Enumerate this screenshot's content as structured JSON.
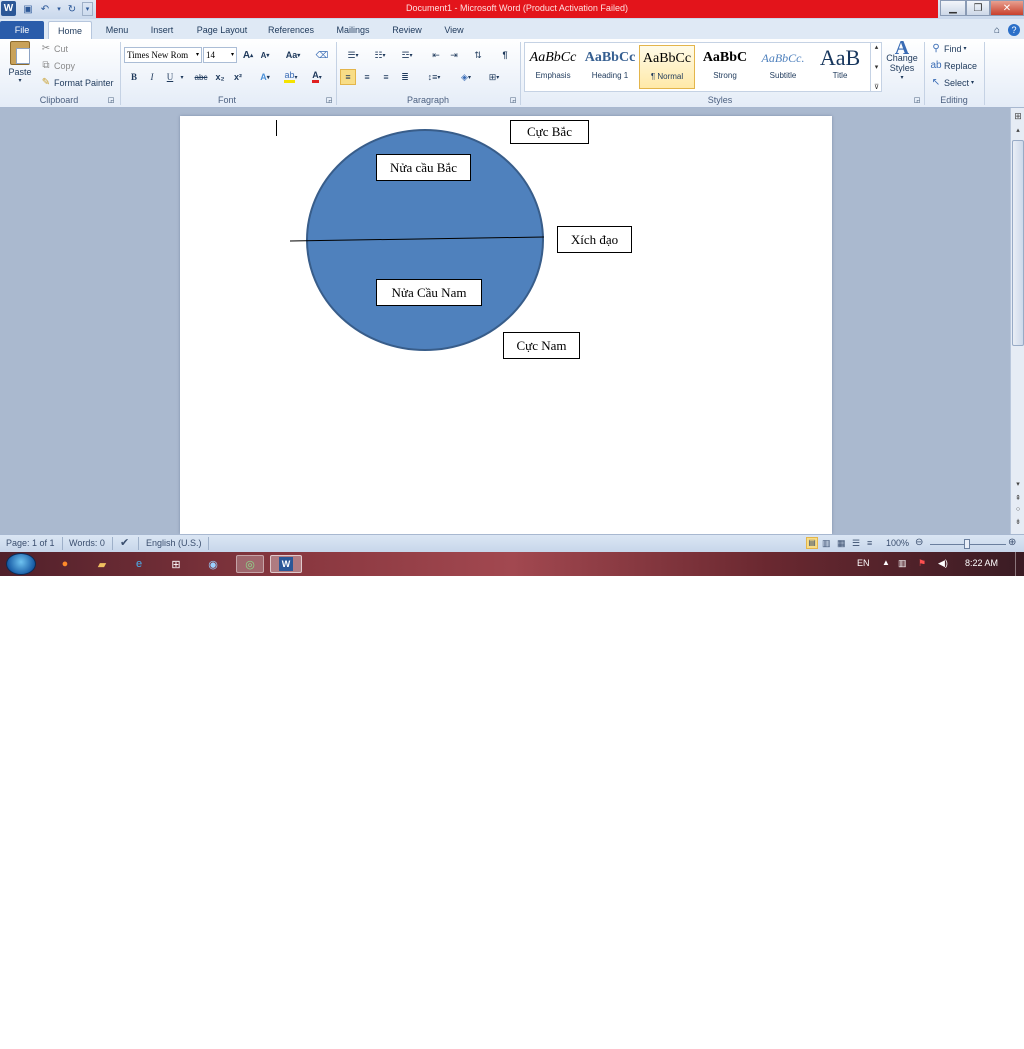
{
  "window": {
    "title": "Document1  -  Microsoft Word (Product Activation Failed)",
    "logo": "W"
  },
  "tabs": [
    "File",
    "Home",
    "Menu",
    "Insert",
    "Page Layout",
    "References",
    "Mailings",
    "Review",
    "View"
  ],
  "clipboard": {
    "paste": "Paste",
    "cut": "Cut",
    "copy": "Copy",
    "format_painter": "Format Painter",
    "label": "Clipboard"
  },
  "font": {
    "name": "Times New Rom",
    "size": "14",
    "label": "Font",
    "bold": "B",
    "italic": "I",
    "underline": "U",
    "strike": "abc",
    "subscript": "x₂",
    "superscript": "x²",
    "change_case": "Aa",
    "grow": "A",
    "shrink": "A"
  },
  "paragraph": {
    "label": "Paragraph",
    "pilcrow": "¶"
  },
  "styles": {
    "label": "Styles",
    "items": [
      {
        "sample": "AaBbCc",
        "name": "Emphasis"
      },
      {
        "sample": "AaBbCc",
        "name": "Heading 1"
      },
      {
        "sample": "AaBbCc",
        "name": "¶ Normal"
      },
      {
        "sample": "AaBbC",
        "name": "Strong"
      },
      {
        "sample": "AaBbCc.",
        "name": "Subtitle"
      },
      {
        "sample": "AaB",
        "name": "Title"
      }
    ],
    "change_styles": "Change Styles"
  },
  "editing": {
    "label": "Editing",
    "find": "Find",
    "replace": "Replace",
    "select": "Select"
  },
  "document": {
    "labels": {
      "north_pole": "Cực Bắc",
      "northern_hemisphere": "Nửa cầu Bắc",
      "equator": "Xích đạo",
      "southern_hemisphere": "Nửa Cầu Nam",
      "south_pole": "Cực Nam"
    },
    "colors": {
      "globe_fill": "#4f81bd",
      "globe_stroke": "#385d8a"
    }
  },
  "status": {
    "page": "Page: 1 of 1",
    "words": "Words: 0",
    "language": "English (U.S.)",
    "zoom": "100%"
  },
  "taskbar": {
    "lang": "EN",
    "time": "8:22 AM"
  }
}
